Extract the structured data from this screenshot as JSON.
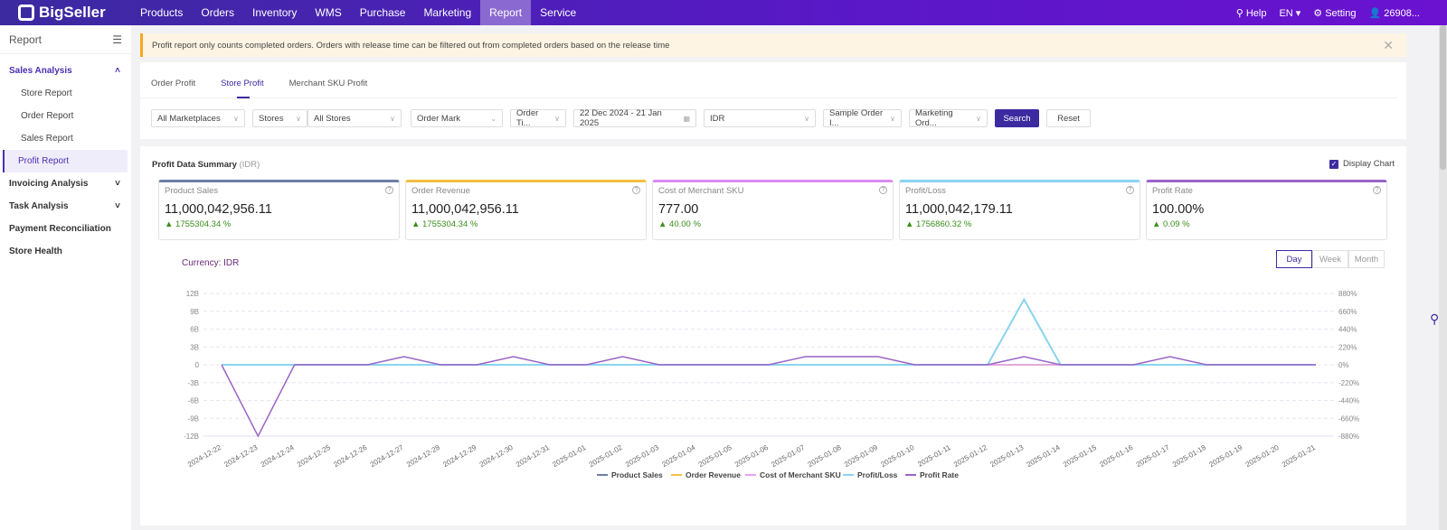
{
  "topbar": {
    "brand": "BigSeller",
    "nav": [
      "Products",
      "Orders",
      "Inventory",
      "WMS",
      "Purchase",
      "Marketing",
      "Report",
      "Service"
    ],
    "active_nav": "Report",
    "help": "Help",
    "lang": "EN",
    "setting": "Setting",
    "user": "26908..."
  },
  "sidebar": {
    "title": "Report",
    "groups": [
      {
        "label": "Sales Analysis",
        "open": true,
        "items": [
          "Store Report",
          "Order Report",
          "Sales Report",
          "Profit Report"
        ]
      },
      {
        "label": "Invoicing Analysis"
      },
      {
        "label": "Task Analysis"
      },
      {
        "label": "Payment Reconciliation"
      },
      {
        "label": "Store Health"
      }
    ],
    "active_item": "Profit Report"
  },
  "notice": "Profit report only counts completed orders. Orders with release time can be filtered out from completed orders based on the release time",
  "tabs": [
    "Order Profit",
    "Store Profit",
    "Merchant SKU Profit"
  ],
  "active_tab": "Store Profit",
  "filters": {
    "marketplace": "All Marketplaces",
    "store_type": "Stores",
    "stores": "All Stores",
    "order_mark": "Order Mark",
    "order_time": "Order Ti...",
    "date_range": "22 Dec 2024  -  21 Jan 2025",
    "currency": "IDR",
    "sample_order": "Sample Order I...",
    "marketing_order": "Marketing Ord...",
    "search": "Search",
    "reset": "Reset"
  },
  "summary": {
    "title": "Profit Data Summary",
    "currency_note": "(IDR)",
    "display_chart": "Display Chart",
    "kpis": [
      {
        "label": "Product Sales",
        "value": "11,000,042,956.11",
        "change": "1755304.34 %",
        "color": "#6b7fa3"
      },
      {
        "label": "Order Revenue",
        "value": "11,000,042,956.11",
        "change": "1755304.34 %",
        "color": "#f5c042"
      },
      {
        "label": "Cost of Merchant SKU",
        "value": "777.00",
        "change": "40.00 %",
        "color": "#d98cf0"
      },
      {
        "label": "Profit/Loss",
        "value": "11,000,042,179.11",
        "change": "1756860.32 %",
        "color": "#8ad4ef"
      },
      {
        "label": "Profit Rate",
        "value": "100.00%",
        "change": "0.09 %",
        "color": "#9a64c8"
      }
    ]
  },
  "period_toggle": [
    "Day",
    "Week",
    "Month"
  ],
  "active_period": "Day",
  "currency_label": "Currency:  IDR",
  "chart_data": {
    "type": "line",
    "x": [
      "2024-12-22",
      "2024-12-23",
      "2024-12-24",
      "2024-12-25",
      "2024-12-26",
      "2024-12-27",
      "2024-12-28",
      "2024-12-29",
      "2024-12-30",
      "2024-12-31",
      "2025-01-01",
      "2025-01-02",
      "2025-01-03",
      "2025-01-04",
      "2025-01-05",
      "2025-01-06",
      "2025-01-07",
      "2025-01-08",
      "2025-01-09",
      "2025-01-10",
      "2025-01-11",
      "2025-01-12",
      "2025-01-13",
      "2025-01-14",
      "2025-01-15",
      "2025-01-16",
      "2025-01-17",
      "2025-01-18",
      "2025-01-19",
      "2025-01-20",
      "2025-01-21"
    ],
    "left_ticks": [
      "12B",
      "9B",
      "6B",
      "3B",
      "0",
      "-3B",
      "-6B",
      "-9B",
      "-12B"
    ],
    "right_ticks": [
      "880%",
      "660%",
      "440%",
      "220%",
      "0%",
      "-220%",
      "-440%",
      "-660%",
      "-880%"
    ],
    "ylim_left": [
      -12000000000,
      12000000000
    ],
    "ylim_right": [
      -880,
      880
    ],
    "series": [
      {
        "name": "Product Sales",
        "color": "#6b7fa3",
        "axis": "left",
        "values": [
          0,
          0,
          0,
          0,
          0,
          0,
          0,
          0,
          0,
          0,
          0,
          0,
          0,
          0,
          0,
          0,
          0,
          0,
          0,
          0,
          0,
          0,
          0,
          0,
          0,
          0,
          0,
          0,
          0,
          0,
          0
        ]
      },
      {
        "name": "Order Revenue",
        "color": "#f5c042",
        "axis": "left",
        "values": [
          0,
          0,
          0,
          0,
          0,
          0,
          0,
          0,
          0,
          0,
          0,
          0,
          0,
          0,
          0,
          0,
          0,
          0,
          0,
          0,
          0,
          0,
          0,
          0,
          0,
          0,
          0,
          0,
          0,
          0,
          0
        ]
      },
      {
        "name": "Cost of Merchant SKU",
        "color": "#e7a0f5",
        "axis": "left",
        "values": [
          0,
          0,
          0,
          0,
          0,
          0,
          0,
          0,
          0,
          0,
          0,
          0,
          0,
          0,
          0,
          0,
          0,
          0,
          0,
          0,
          0,
          0,
          777,
          0,
          0,
          0,
          0,
          0,
          0,
          0,
          0
        ]
      },
      {
        "name": "Profit/Loss",
        "color": "#8ad4ef",
        "axis": "left",
        "values": [
          0,
          0,
          0,
          0,
          0,
          0,
          0,
          0,
          0,
          0,
          0,
          0,
          0,
          0,
          0,
          0,
          0,
          0,
          0,
          0,
          0,
          0,
          11000000000,
          0,
          0,
          0,
          0,
          0,
          0,
          0,
          0
        ]
      },
      {
        "name": "Profit Rate",
        "color": "#9a64c8",
        "axis": "right",
        "values": [
          0,
          -880,
          0,
          0,
          0,
          100,
          0,
          0,
          100,
          0,
          0,
          100,
          0,
          0,
          0,
          0,
          100,
          100,
          100,
          0,
          0,
          0,
          100,
          0,
          0,
          0,
          100,
          0,
          0,
          0,
          0
        ]
      }
    ],
    "legend": "bottom",
    "grid": true
  }
}
